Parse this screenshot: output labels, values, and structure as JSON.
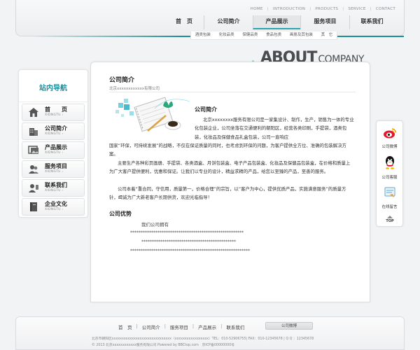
{
  "header": {
    "small_nav": [
      "HOME",
      "INTRODUCTION",
      "PRODUCTS",
      "SERVICE",
      "CONTACT"
    ],
    "main_nav": [
      "首　页",
      "公司简介",
      "产品展示",
      "服务项目",
      "联系我们"
    ],
    "active_index": 2,
    "sub_nav": [
      "酒类包装",
      "化妆品类",
      "保健品类",
      "食品包类",
      "画册及其包装",
      "其　它"
    ]
  },
  "banner": {
    "about": "ABOUT",
    "company": "COMPANY"
  },
  "sidebar": {
    "title": "站内导航",
    "items": [
      {
        "label": "首　　页",
        "en": "XIDNGTU ›",
        "icon": "home-icon"
      },
      {
        "label": "公司简介",
        "en": "XIDNGTU ›",
        "icon": "building-icon"
      },
      {
        "label": "产品展示",
        "en": "XIDNGTU ›",
        "icon": "gallery-icon"
      },
      {
        "label": "服务项目",
        "en": "XIDNGTU ›",
        "icon": "people-icon"
      },
      {
        "label": "联系我们",
        "en": "XIDNGTU ›",
        "icon": "contact-icon"
      },
      {
        "label": "企业文化",
        "en": "XIDNGTU ›",
        "icon": "book-icon"
      }
    ]
  },
  "content": {
    "heading": "公司简介",
    "breadcrumb": "北京xxxxxxxxxxxx有限公司",
    "intro_title": "公司简介",
    "para1": "北京xxxxxxxx服务有限公司是一家集设计、制作，生产，销售为一体的专业化包装企业，公司坐落在交通便利的朝阳区，经营各类印刷，手提袋，酒类包装，化妆品及保健食品礼盒包装，公司一直响应国家“环保，可持续发展”的战略，不仅在保证质量的同时，也考虑到环保的问题，为客户提供全方位、准确的包装解决方案。",
    "para2": "主要生产各种彩页画册、手提袋、各类酒盒、月饼包装盒、电子产品包装盒、化妆品及保健品包装盒，在价格和质量上为广大客户提供便利，优惠和保证。让我们以专业的设计，精益求精的产品，给您以至臻的产品，至善的服务。",
    "para3": "公司本着“重合同，守信用，质量第一，价格合理”的宗旨，以“客户为中心，提供优质产品，实施满意服务”的质量方针，竭诚为广大新老客户长期供货，欢迎光临指导！",
    "advantage_title": "公司优势",
    "advantage_intro": "我们公司拥有",
    "stars": [
      "******************************************************",
      "*********************************************",
      "*********************************************************"
    ]
  },
  "float_bar": {
    "items": [
      {
        "label": "公司微博",
        "icon": "weibo-icon"
      },
      {
        "label": "公司客服",
        "icon": "qq-penguin-icon"
      },
      {
        "label": "在线留言",
        "icon": "message-board-icon"
      }
    ],
    "top": "TOP"
  },
  "footer": {
    "links": [
      "首　页",
      "公司简介",
      "服务项目",
      "产品展示",
      "联系我们"
    ],
    "button": "公司微博",
    "line1": "北京市朝阳区xxxxxxxxxxxxxxxxxxxxxxxxxxxxxx（xxxxxxxxxxxxxxxxx）TEL：010-52906755| FAX：010-12345678 | Q Q ：12345678",
    "line2": "© 2013 北京xxxxxxxxxxxx服务有限公司 Powered by BBCtop.com　京ICP备00000000号"
  },
  "colors": {
    "accent": "#1f8e9c",
    "nav_underline": "#2aa4b0"
  }
}
